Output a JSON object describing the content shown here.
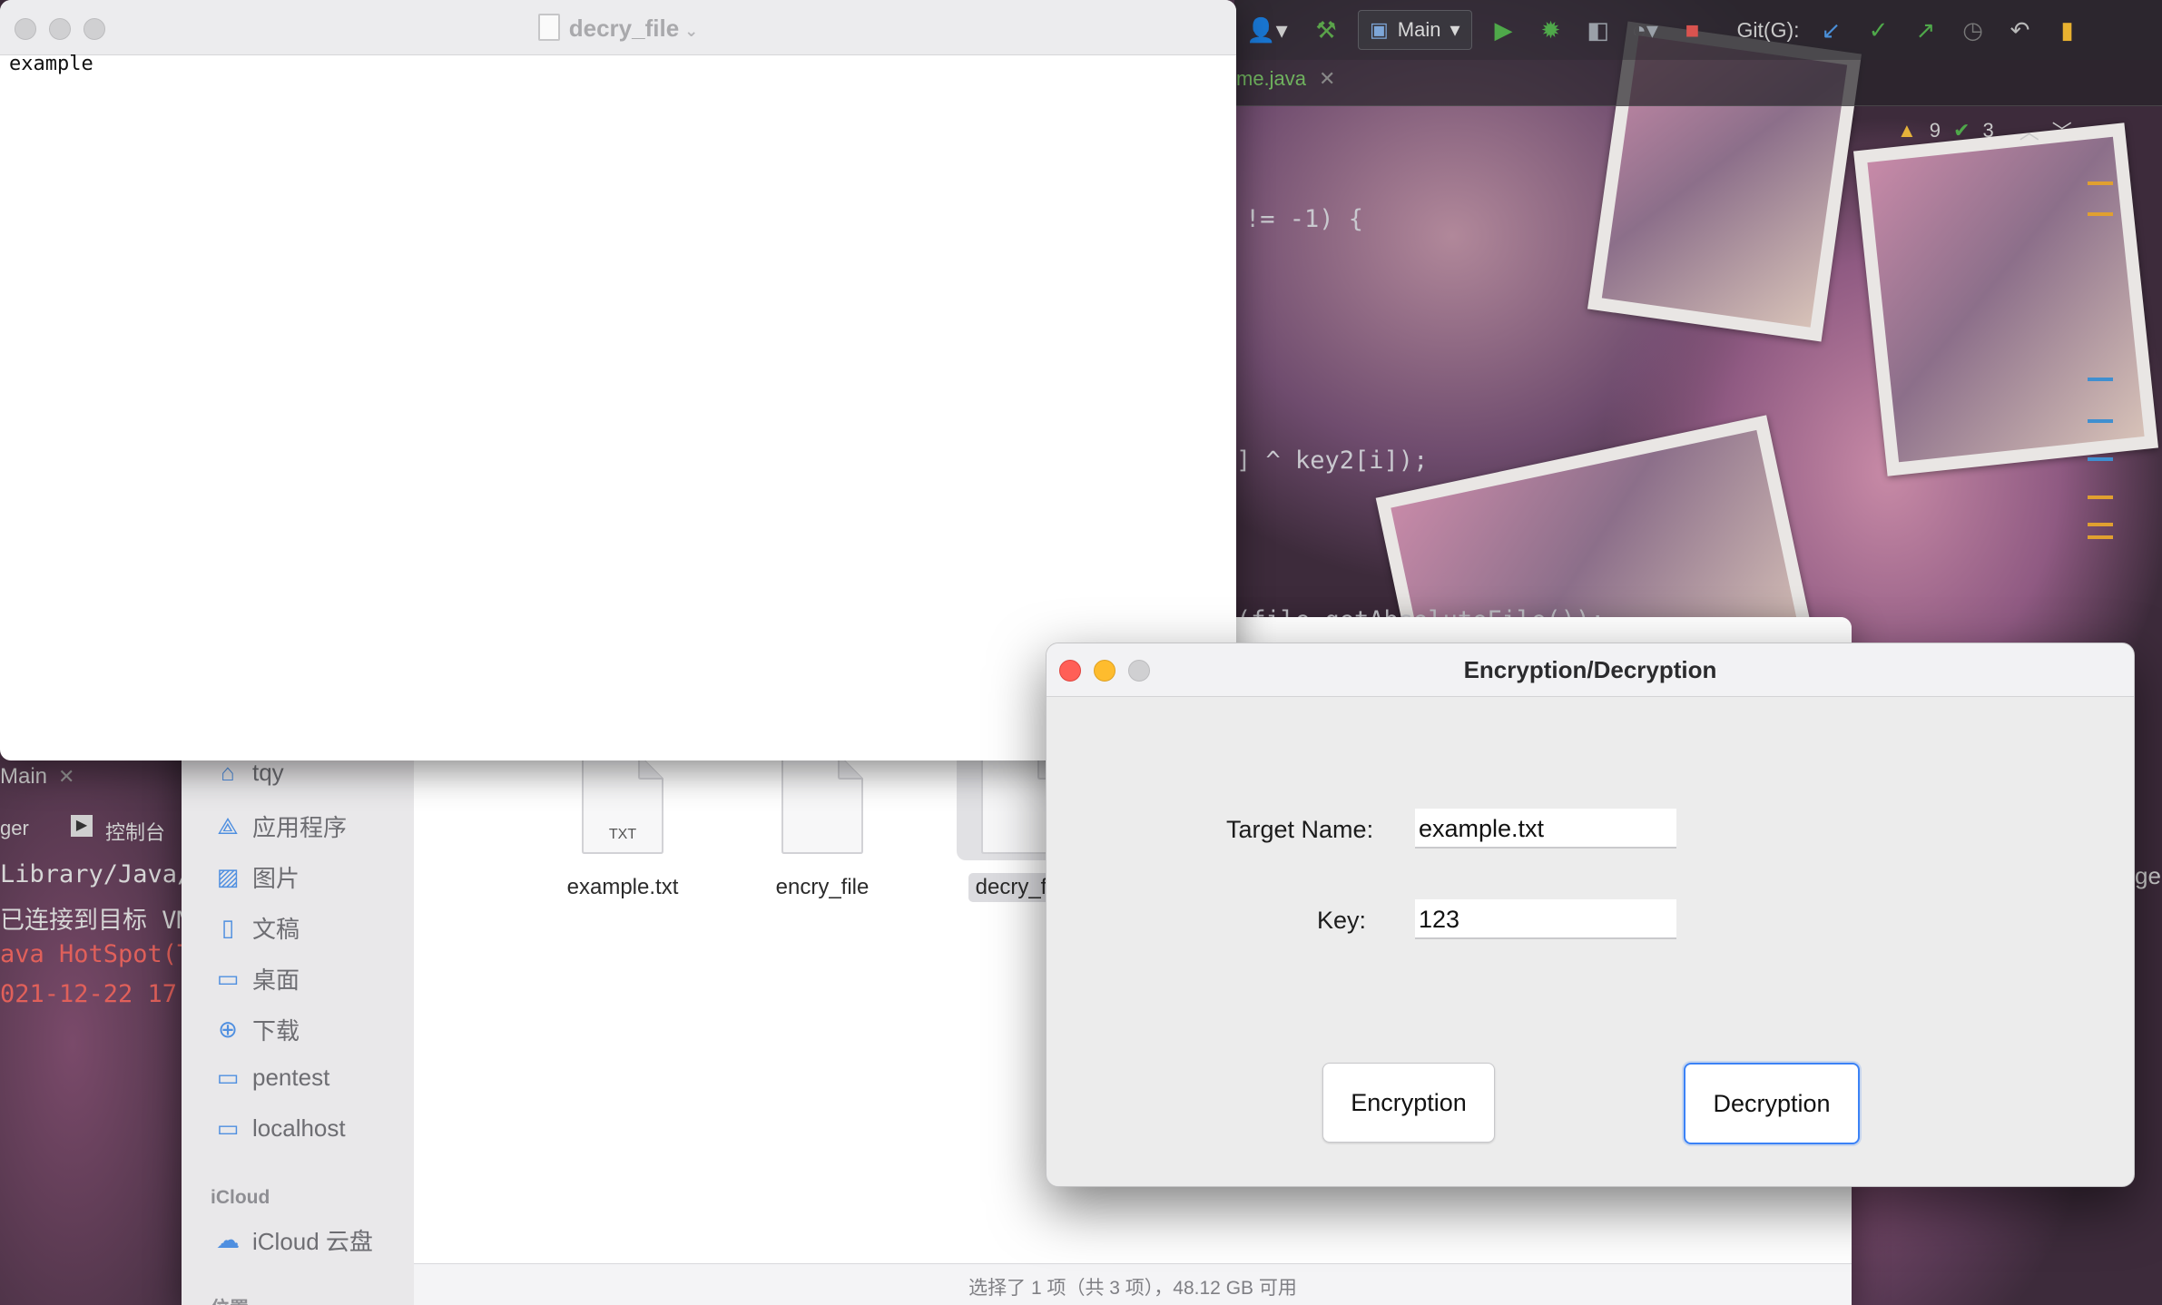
{
  "textedit": {
    "title": "decry_file",
    "content": "example"
  },
  "ide": {
    "run_config": "Main",
    "git_label": "Git(G):",
    "editor_tab": "me.java",
    "warnings_count": "9",
    "checks_count": "3",
    "code_lines": [
      "!= -1) {",
      "] ^ key2[i]);",
      "(file.getAbsoluteFile());"
    ],
    "left_tab": "Main",
    "console_toolbar_left": "ger",
    "console_tab": "控制台",
    "console_lines": [
      "Library/Java/",
      "已连接到目标 VM,",
      "ava HotSpot(T",
      "021-12-22 17:"
    ],
    "right_edge_text": "ge"
  },
  "finder": {
    "sidebar_items": [
      {
        "icon": "home-icon",
        "label": "tqy"
      },
      {
        "icon": "applications-icon",
        "label": "应用程序"
      },
      {
        "icon": "pictures-icon",
        "label": "图片"
      },
      {
        "icon": "documents-icon",
        "label": "文稿"
      },
      {
        "icon": "desktop-icon",
        "label": "桌面"
      },
      {
        "icon": "downloads-icon",
        "label": "下载"
      },
      {
        "icon": "folder-icon",
        "label": "pentest"
      },
      {
        "icon": "folder-icon",
        "label": "localhost"
      }
    ],
    "icloud_section": "iCloud",
    "icloud_item": "iCloud 云盘",
    "next_section": "位置",
    "files": [
      {
        "name": "example.txt",
        "badge": "TXT",
        "selected": false
      },
      {
        "name": "encry_file",
        "badge": "",
        "selected": false
      },
      {
        "name": "decry_file",
        "badge": "",
        "selected": true
      }
    ],
    "status_text": "选择了 1 项（共 3 项），48.12 GB 可用",
    "zoom_level": 0.15
  },
  "dialog": {
    "title": "Encryption/Decryption",
    "target_label": "Target Name:",
    "target_value": "example.txt",
    "key_label": "Key:",
    "key_value": "123",
    "encrypt_button": "Encryption",
    "decrypt_button": "Decryption"
  },
  "colors": {
    "traffic_close": "#ff5f57",
    "traffic_minimize": "#febc2e",
    "traffic_inactive": "#d0d0d2",
    "accent_blue": "#3b82f6",
    "console_error": "#e0605a"
  }
}
